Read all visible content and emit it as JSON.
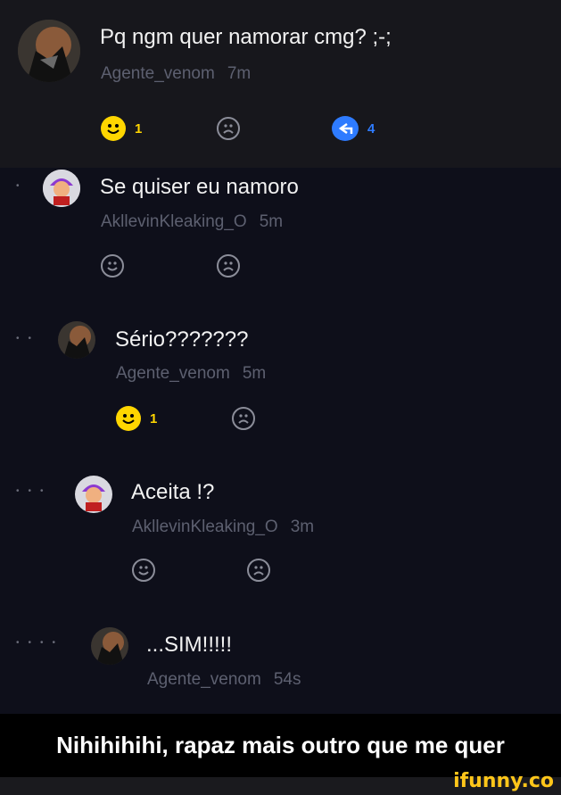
{
  "comments": [
    {
      "text": "Pq ngm quer namorar cmg? ;-;",
      "author": "Agente_venom",
      "time": "7m",
      "smile_count": "1",
      "reply_count": "4",
      "depth": 0
    },
    {
      "text": "Se quiser eu namoro",
      "author": "AkllevinKleaking_O",
      "time": "5m",
      "depth": 1
    },
    {
      "text": "Sério???????",
      "author": "Agente_venom",
      "time": "5m",
      "smile_count": "1",
      "depth": 2
    },
    {
      "text": "Aceita !?",
      "author": "AkllevinKleaking_O",
      "time": "3m",
      "depth": 3
    },
    {
      "text": "...SIM!!!!!",
      "author": "Agente_venom",
      "time": "54s",
      "depth": 4
    }
  ],
  "caption": "Nihihihihi, rapaz mais outro que me quer",
  "watermark": "ifunny.co",
  "icons": {
    "smile_active": "smile-icon",
    "smile": "smile-icon",
    "frown": "frown-icon",
    "reply": "reply-icon"
  },
  "colors": {
    "background": "#0e0f1a",
    "top_comment_bg": "#17171c",
    "smile_active": "#ffd600",
    "reply": "#2e7bff",
    "meta": "#5d6070",
    "watermark": "#ffc61a"
  }
}
